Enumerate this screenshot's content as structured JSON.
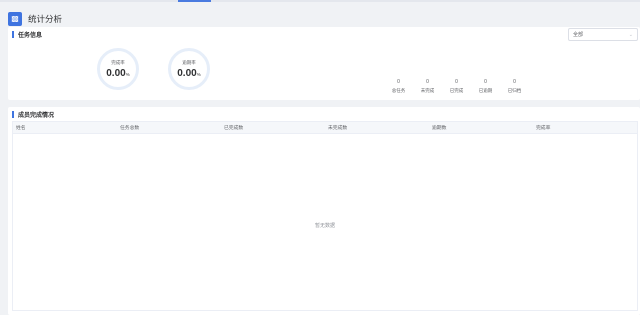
{
  "header": {
    "title": "统计分析",
    "icon": "chart-icon"
  },
  "overview": {
    "section_title": "任务信息",
    "filter": {
      "selected": "全部"
    },
    "rings": [
      {
        "label": "完成率",
        "value": "0.00",
        "unit": "%"
      },
      {
        "label": "逾期率",
        "value": "0.00",
        "unit": "%"
      }
    ],
    "stats": [
      {
        "value": "0",
        "label": "总任务"
      },
      {
        "value": "0",
        "label": "未完成"
      },
      {
        "value": "0",
        "label": "已完成"
      },
      {
        "value": "0",
        "label": "已逾期"
      },
      {
        "value": "0",
        "label": "已归档"
      }
    ]
  },
  "members": {
    "section_title": "成员完成情况",
    "columns": [
      "姓名",
      "任务总数",
      "已完成数",
      "未完成数",
      "逾期数",
      "完成率"
    ],
    "empty_text": "暂无数据"
  },
  "colors": {
    "accent": "#3f74e0"
  }
}
